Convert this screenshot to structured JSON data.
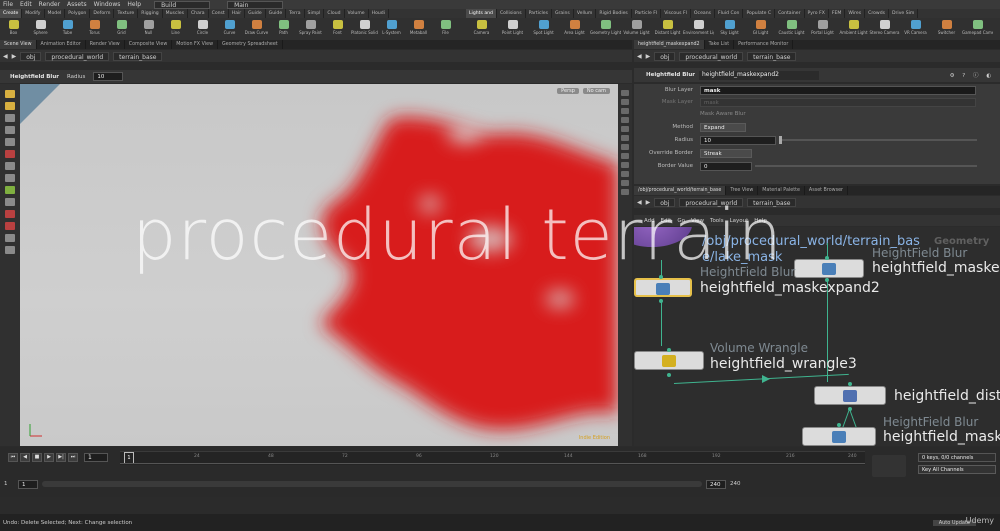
{
  "menubar": {
    "items": [
      "File",
      "Edit",
      "Render",
      "Assets",
      "Windows",
      "Help"
    ],
    "desktop_label": "Build",
    "desktop2_label": "Main"
  },
  "shelf_tabs_left": [
    "Create",
    "Modify",
    "Model",
    "Polygon",
    "Deform",
    "Texture",
    "Rigging",
    "Muscles",
    "Chara",
    "Const",
    "Hair",
    "Guide",
    "Guide",
    "Terra",
    "Simpl",
    "Cloud",
    "Volume",
    "Houdi"
  ],
  "shelf_tabs_right": [
    "Lights and",
    "Collisions",
    "Particles",
    "Grains",
    "Vellum",
    "Rigid Bodies",
    "Particle Fl",
    "Viscous Fl",
    "Oceans",
    "Fluid Con",
    "Populate C",
    "Container",
    "Pyro FX",
    "FEM",
    "Wires",
    "Crowds",
    "Drive Sim"
  ],
  "shelf_tools_left": [
    "Box",
    "Sphere",
    "Tube",
    "Torus",
    "Grid",
    "Null",
    "Line",
    "Circle",
    "Curve",
    "Draw Curve",
    "Path",
    "Spray Paint",
    "Font",
    "Platonic Solids",
    "L-System",
    "Metaball",
    "File"
  ],
  "shelf_tools_right": [
    "Camera",
    "Point Light",
    "Spot Light",
    "Area Light",
    "Geometry Light",
    "Volume Light",
    "Distant Light",
    "Environment Light",
    "Sky Light",
    "GI Light",
    "Caustic Light",
    "Portal Light",
    "Ambient Light",
    "Stereo Camera",
    "VR Camera",
    "Switcher",
    "Gamepad Camera"
  ],
  "left_pane_tabs": [
    "Scene View",
    "Animation Editor",
    "Render View",
    "Composite View",
    "Motion FX View",
    "Geometry Spreadsheet"
  ],
  "right_pane_tabs": [
    "heightfield_maskexpand2",
    "Take List",
    "Performance Monitor"
  ],
  "left_path": {
    "obj": "obj",
    "procedural": "procedural_world",
    "terrain": "terrain_base"
  },
  "right_path": {
    "obj": "obj",
    "procedural": "procedural_world",
    "terrain": "terrain_base"
  },
  "viewport": {
    "tool_label": "Heightfield Blur",
    "radius_label": "Radius",
    "radius_value": "10",
    "persp_label": "Persp",
    "cam_label": "No cam",
    "edition_label": "Indie Edition"
  },
  "watermark": "procedural terrain",
  "params": {
    "node_type": "Heightfield Blur",
    "node_name": "heightfield_maskexpand2",
    "blur_layer_label": "Blur Layer",
    "blur_layer_value": "mask",
    "mask_layer_label": "Mask Layer",
    "mask_layer_value": "mask",
    "mask_aware_label": "Mask Aware Blur",
    "method_label": "Method",
    "method_value": "Expand",
    "radius_label": "Radius",
    "radius_value": "10",
    "override_label": "Override Border",
    "override_value": "Streak",
    "border_label": "Border Value",
    "border_value": "0"
  },
  "network_tabs": [
    "/obj/procedural_world/terrain_base",
    "Tree View",
    "Material Palette",
    "Asset Browser"
  ],
  "network_menu": [
    "Add",
    "Edit",
    "Go",
    "View",
    "Tools",
    "Layout",
    "Help"
  ],
  "network": {
    "header_path": "/obj/procedural_world/terrain_bas\ne/lake_mask",
    "context_label": "Geometry",
    "nodes": [
      {
        "type": "HeightField Blur",
        "name": "heightfield_maske"
      },
      {
        "type": "HeightField Blur",
        "name": "heightfield_maskexpand2"
      },
      {
        "type": "Volume Wrangle",
        "name": "heightfield_wrangle3"
      },
      {
        "type": "",
        "name": "heightfield_dist"
      },
      {
        "type": "HeightField Blur",
        "name": "heightfield_mask"
      }
    ]
  },
  "timeline": {
    "current_frame": "1",
    "frame_marker": "1",
    "ticks": [
      "24",
      "48",
      "72",
      "96",
      "120",
      "144",
      "168",
      "192",
      "216",
      "240"
    ],
    "start": "1",
    "start2": "1",
    "end": "240",
    "end2": "240",
    "keys_label": "0 keys, 0/0 channels",
    "key_all_label": "Key All Channels",
    "auto_update": "Auto Update"
  },
  "status": "Undo: Delete Selected; Next: Change selection",
  "overlay_brand": "Udemy"
}
